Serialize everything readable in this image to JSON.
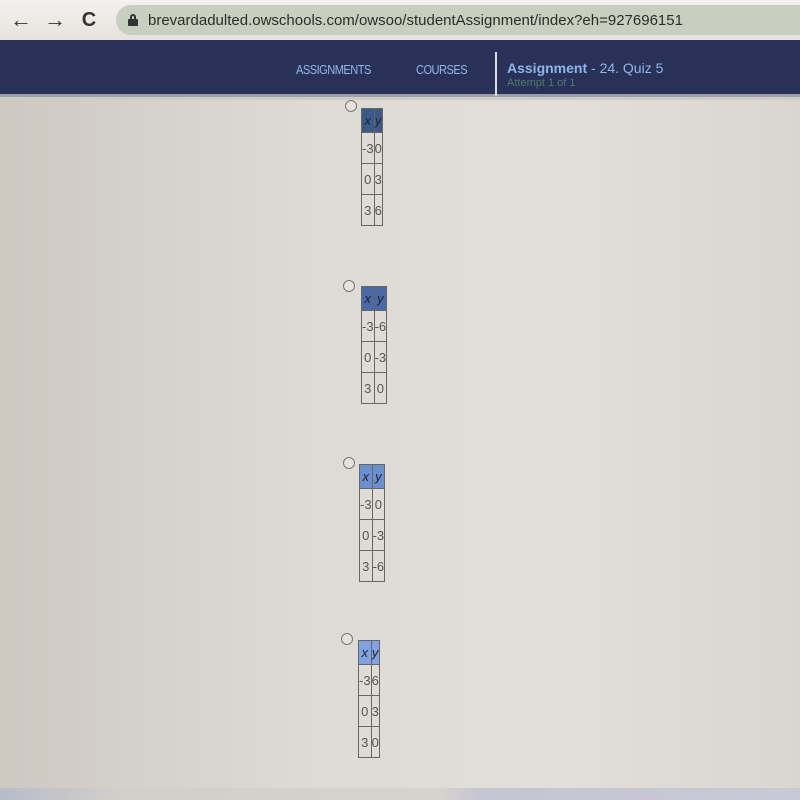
{
  "browser": {
    "back_icon": "←",
    "forward_icon": "→",
    "reload_icon": "C",
    "url": "brevardadulted.owschools.com/owsoo/studentAssignment/index?eh=927696151"
  },
  "header": {
    "nav": [
      "ASSIGNMENTS",
      "COURSES"
    ],
    "assignment_label": "Assignment",
    "assignment_name": " - 24. Quiz 5",
    "attempt": "Attempt 1 of 1"
  },
  "options": [
    {
      "headers": [
        "x",
        "y"
      ],
      "rows": [
        [
          "-3",
          "0"
        ],
        [
          "0",
          "3"
        ],
        [
          "3",
          "6"
        ]
      ],
      "header_color": "#3d5a86"
    },
    {
      "headers": [
        "x",
        "y"
      ],
      "rows": [
        [
          "-3",
          "-6"
        ],
        [
          "0",
          "-3"
        ],
        [
          "3",
          "0"
        ]
      ],
      "header_color": "#4a6aa5"
    },
    {
      "headers": [
        "x",
        "y"
      ],
      "rows": [
        [
          "-3",
          "0"
        ],
        [
          "0",
          "-3"
        ],
        [
          "3",
          "-6"
        ]
      ],
      "header_color": "#6c8fd0"
    },
    {
      "headers": [
        "x",
        "y"
      ],
      "rows": [
        [
          "-3",
          "6"
        ],
        [
          "0",
          "3"
        ],
        [
          "3",
          "0"
        ]
      ],
      "header_color": "#7fa2e2"
    }
  ]
}
